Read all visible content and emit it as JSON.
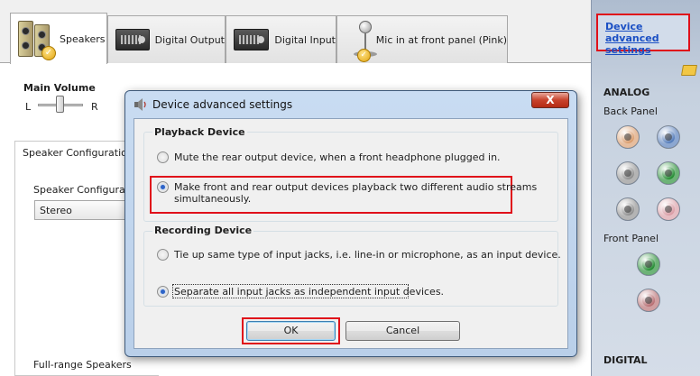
{
  "tabs": [
    {
      "label": "Speakers",
      "active": true
    },
    {
      "label": "Digital Output"
    },
    {
      "label": "Digital Input"
    },
    {
      "label": "Mic in at front panel (Pink)"
    }
  ],
  "main": {
    "main_volume_label": "Main Volume",
    "left_label": "L",
    "right_label": "R",
    "speaker_config_title": "Speaker Configuration",
    "speaker_config_sub": "Speaker Configuratio",
    "speaker_config_value": "Stereo",
    "full_range_label": "Full-range Speakers"
  },
  "sidebar": {
    "advanced_link": "Device advanced settings",
    "analog_heading": "ANALOG",
    "back_panel_label": "Back Panel",
    "front_panel_label": "Front Panel",
    "digital_heading": "DIGITAL",
    "jacks": [
      {
        "name": "back-jack-orange",
        "color": "#d99a6a"
      },
      {
        "name": "back-jack-blue",
        "color": "#4f78b8"
      },
      {
        "name": "back-jack-gray",
        "color": "#8c8c8c"
      },
      {
        "name": "back-jack-green-active",
        "color": "#1f8a2e"
      },
      {
        "name": "back-jack-gray-2",
        "color": "#8c8c8c"
      },
      {
        "name": "back-jack-pink",
        "color": "#d99aa3"
      },
      {
        "name": "front-jack-green",
        "color": "#1f8a2e"
      },
      {
        "name": "front-jack-pink",
        "color": "#b56a6e"
      }
    ]
  },
  "dialog": {
    "title": "Device advanced settings",
    "close_label": "X",
    "playback_group_label": "Playback Device",
    "playback_options": [
      {
        "label": "Mute the rear output device, when a front headphone plugged in.",
        "checked": false
      },
      {
        "label_line1": "Make front and rear output devices playback two different audio streams",
        "label_line2": "simultaneously.",
        "checked": true
      }
    ],
    "recording_group_label": "Recording Device",
    "recording_options": [
      {
        "label": "Tie up same type of input jacks, i.e. line-in or microphone, as an input device.",
        "checked": false
      },
      {
        "label": "Separate all input jacks as independent input devices.",
        "checked": true
      }
    ],
    "ok_label": "OK",
    "cancel_label": "Cancel"
  },
  "colors": {
    "highlight_red": "#e0101a",
    "link_blue": "#1a4fc4",
    "radio_selected": "#2e64c8"
  }
}
